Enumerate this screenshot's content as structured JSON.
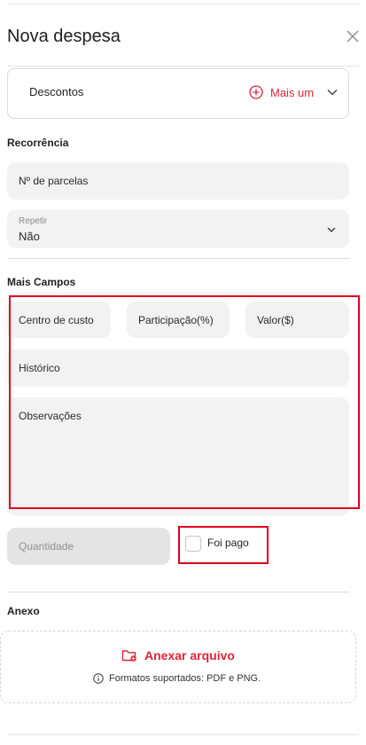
{
  "header": {
    "title": "Nova despesa"
  },
  "descontos": {
    "label": "Descontos",
    "add_label": "Mais um"
  },
  "recorrencia": {
    "title": "Recorrência",
    "parcelas_placeholder": "Nº de parcelas",
    "repetir_label": "Repetir",
    "repetir_value": "Não"
  },
  "mais_campos": {
    "title": "Mais Campos",
    "centro_custo": "Centro de custo",
    "participacao": "Participação(%)",
    "valor": "Valor($)",
    "historico": "Histórico",
    "observacoes": "Observações",
    "quantidade": "Quantidade",
    "foi_pago": "Foi pago"
  },
  "anexo": {
    "title": "Anexo",
    "attach_label": "Anexar arquivo",
    "formats": "Formatos suportados: PDF e PNG."
  },
  "colors": {
    "accent": "#e0243b",
    "highlight": "#e0001b",
    "field_bg": "#f2f2f2"
  }
}
